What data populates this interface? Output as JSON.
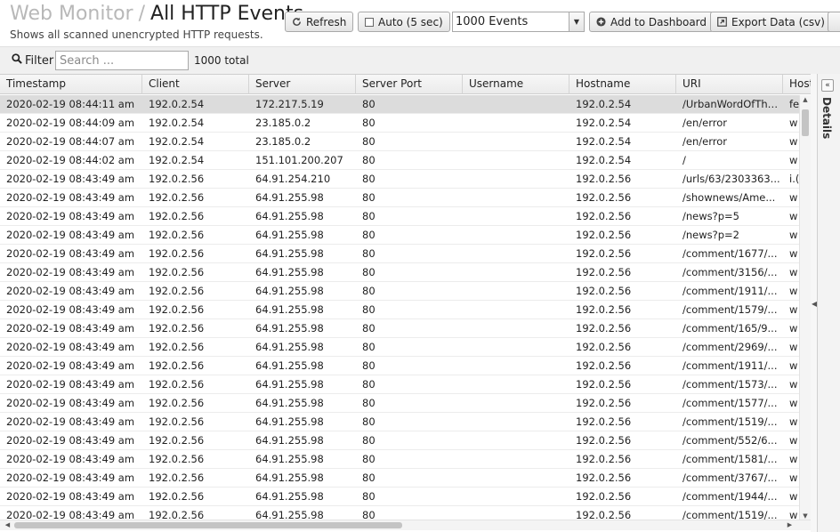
{
  "header": {
    "parent_title": "Web Monitor",
    "separator": "/",
    "page_title": "All HTTP Events",
    "subtitle": "Shows all scanned unencrypted HTTP requests."
  },
  "toolbar": {
    "refresh_label": "Refresh",
    "auto_label": "Auto (5 sec)",
    "auto_checked": false,
    "events_select_value": "1000 Events",
    "add_dashboard_label": "Add to Dashboard",
    "export_label": "Export Data (csv)"
  },
  "filter": {
    "label": "Filter",
    "placeholder": "Search ...",
    "value": "",
    "total_text": "1000 total"
  },
  "table": {
    "columns": [
      "Timestamp",
      "Client",
      "Server",
      "Server Port",
      "Username",
      "Hostname",
      "URI",
      "Host"
    ],
    "rows": [
      {
        "timestamp": "2020-02-19 08:44:11 am",
        "client": "192.0.2.54",
        "server": "172.217.5.19",
        "port": "80",
        "username": "",
        "hostname": "192.0.2.54",
        "uri": "/UrbanWordOfTheDay",
        "host": "fe",
        "selected": true
      },
      {
        "timestamp": "2020-02-19 08:44:09 am",
        "client": "192.0.2.54",
        "server": "23.185.0.2",
        "port": "80",
        "username": "",
        "hostname": "192.0.2.54",
        "uri": "/en/error",
        "host": "w"
      },
      {
        "timestamp": "2020-02-19 08:44:07 am",
        "client": "192.0.2.54",
        "server": "23.185.0.2",
        "port": "80",
        "username": "",
        "hostname": "192.0.2.54",
        "uri": "/en/error",
        "host": "w"
      },
      {
        "timestamp": "2020-02-19 08:44:02 am",
        "client": "192.0.2.54",
        "server": "151.101.200.207",
        "port": "80",
        "username": "",
        "hostname": "192.0.2.54",
        "uri": "/",
        "host": "w"
      },
      {
        "timestamp": "2020-02-19 08:43:49 am",
        "client": "192.0.2.56",
        "server": "64.91.254.210",
        "port": "80",
        "username": "",
        "hostname": "192.0.2.56",
        "uri": "/urls/63/2303363...",
        "host": "i.("
      },
      {
        "timestamp": "2020-02-19 08:43:49 am",
        "client": "192.0.2.56",
        "server": "64.91.255.98",
        "port": "80",
        "username": "",
        "hostname": "192.0.2.56",
        "uri": "/shownews/Ame...",
        "host": "w"
      },
      {
        "timestamp": "2020-02-19 08:43:49 am",
        "client": "192.0.2.56",
        "server": "64.91.255.98",
        "port": "80",
        "username": "",
        "hostname": "192.0.2.56",
        "uri": "/news?p=5",
        "host": "w"
      },
      {
        "timestamp": "2020-02-19 08:43:49 am",
        "client": "192.0.2.56",
        "server": "64.91.255.98",
        "port": "80",
        "username": "",
        "hostname": "192.0.2.56",
        "uri": "/news?p=2",
        "host": "w"
      },
      {
        "timestamp": "2020-02-19 08:43:49 am",
        "client": "192.0.2.56",
        "server": "64.91.255.98",
        "port": "80",
        "username": "",
        "hostname": "192.0.2.56",
        "uri": "/comment/1677/...",
        "host": "w"
      },
      {
        "timestamp": "2020-02-19 08:43:49 am",
        "client": "192.0.2.56",
        "server": "64.91.255.98",
        "port": "80",
        "username": "",
        "hostname": "192.0.2.56",
        "uri": "/comment/3156/...",
        "host": "w"
      },
      {
        "timestamp": "2020-02-19 08:43:49 am",
        "client": "192.0.2.56",
        "server": "64.91.255.98",
        "port": "80",
        "username": "",
        "hostname": "192.0.2.56",
        "uri": "/comment/1911/...",
        "host": "w"
      },
      {
        "timestamp": "2020-02-19 08:43:49 am",
        "client": "192.0.2.56",
        "server": "64.91.255.98",
        "port": "80",
        "username": "",
        "hostname": "192.0.2.56",
        "uri": "/comment/1579/...",
        "host": "w"
      },
      {
        "timestamp": "2020-02-19 08:43:49 am",
        "client": "192.0.2.56",
        "server": "64.91.255.98",
        "port": "80",
        "username": "",
        "hostname": "192.0.2.56",
        "uri": "/comment/165/9...",
        "host": "w"
      },
      {
        "timestamp": "2020-02-19 08:43:49 am",
        "client": "192.0.2.56",
        "server": "64.91.255.98",
        "port": "80",
        "username": "",
        "hostname": "192.0.2.56",
        "uri": "/comment/2969/...",
        "host": "w"
      },
      {
        "timestamp": "2020-02-19 08:43:49 am",
        "client": "192.0.2.56",
        "server": "64.91.255.98",
        "port": "80",
        "username": "",
        "hostname": "192.0.2.56",
        "uri": "/comment/1911/...",
        "host": "w"
      },
      {
        "timestamp": "2020-02-19 08:43:49 am",
        "client": "192.0.2.56",
        "server": "64.91.255.98",
        "port": "80",
        "username": "",
        "hostname": "192.0.2.56",
        "uri": "/comment/1573/...",
        "host": "w"
      },
      {
        "timestamp": "2020-02-19 08:43:49 am",
        "client": "192.0.2.56",
        "server": "64.91.255.98",
        "port": "80",
        "username": "",
        "hostname": "192.0.2.56",
        "uri": "/comment/1577/...",
        "host": "w"
      },
      {
        "timestamp": "2020-02-19 08:43:49 am",
        "client": "192.0.2.56",
        "server": "64.91.255.98",
        "port": "80",
        "username": "",
        "hostname": "192.0.2.56",
        "uri": "/comment/1519/...",
        "host": "w"
      },
      {
        "timestamp": "2020-02-19 08:43:49 am",
        "client": "192.0.2.56",
        "server": "64.91.255.98",
        "port": "80",
        "username": "",
        "hostname": "192.0.2.56",
        "uri": "/comment/552/6...",
        "host": "w"
      },
      {
        "timestamp": "2020-02-19 08:43:49 am",
        "client": "192.0.2.56",
        "server": "64.91.255.98",
        "port": "80",
        "username": "",
        "hostname": "192.0.2.56",
        "uri": "/comment/1581/...",
        "host": "w"
      },
      {
        "timestamp": "2020-02-19 08:43:49 am",
        "client": "192.0.2.56",
        "server": "64.91.255.98",
        "port": "80",
        "username": "",
        "hostname": "192.0.2.56",
        "uri": "/comment/3767/...",
        "host": "w"
      },
      {
        "timestamp": "2020-02-19 08:43:49 am",
        "client": "192.0.2.56",
        "server": "64.91.255.98",
        "port": "80",
        "username": "",
        "hostname": "192.0.2.56",
        "uri": "/comment/1944/...",
        "host": "w"
      },
      {
        "timestamp": "2020-02-19 08:43:49 am",
        "client": "192.0.2.56",
        "server": "64.91.255.98",
        "port": "80",
        "username": "",
        "hostname": "192.0.2.56",
        "uri": "/comment/1519/...",
        "host": "w"
      }
    ]
  },
  "details_panel": {
    "label": "Details"
  },
  "icons": {
    "refresh": "refresh-icon",
    "add": "plus-circle-icon",
    "export": "export-icon",
    "search": "search-icon",
    "collapse": "double-chevron-left-icon"
  },
  "colors": {
    "selected_row": "#dcdcdc",
    "title_parent": "#b8b8b8",
    "filter_bar": "#f0f0f0"
  }
}
